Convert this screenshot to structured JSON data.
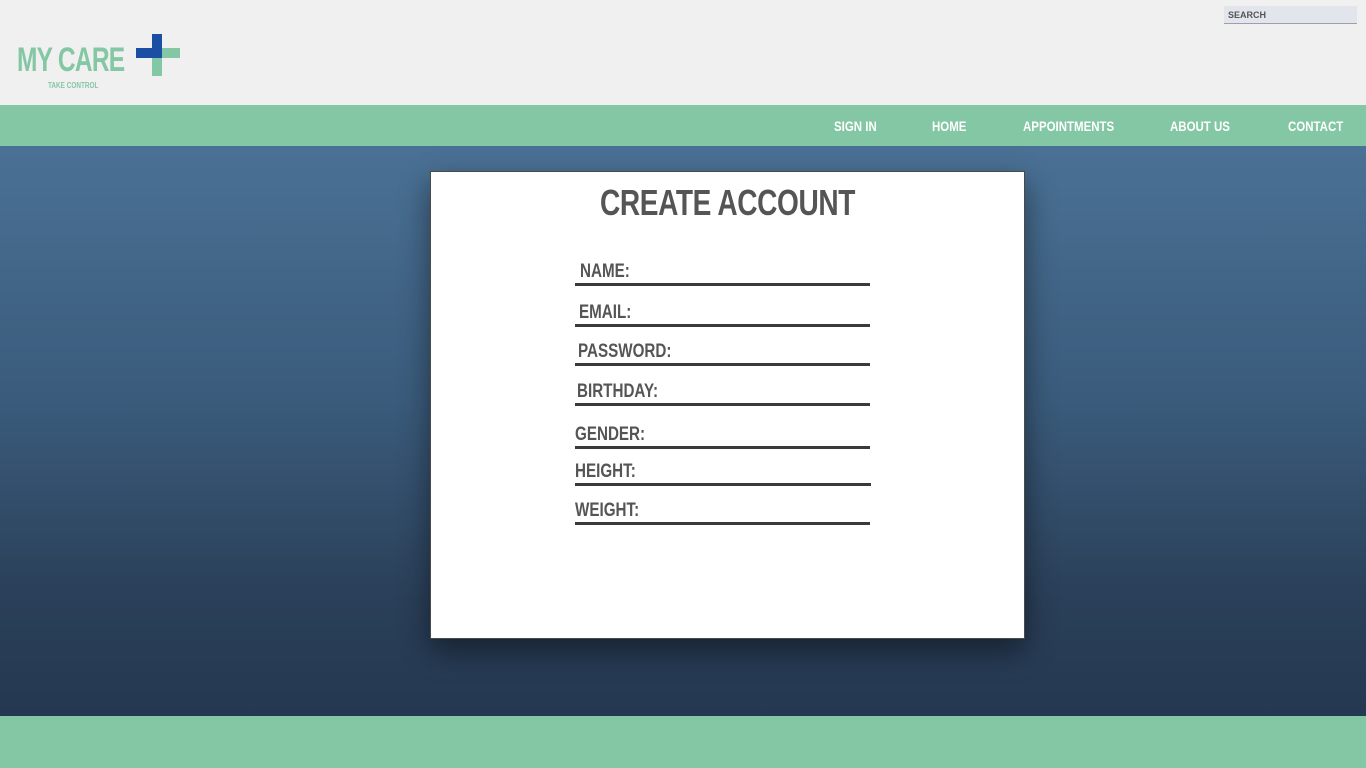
{
  "brand": {
    "name": "MY CARE",
    "tagline": "TAKE CONTROL",
    "cross_colors": {
      "vertical": "#1b4fa3",
      "horizontal": "#84c7a4"
    }
  },
  "search": {
    "placeholder": "SEARCH",
    "value": ""
  },
  "nav": {
    "items": [
      {
        "label": "SIGN IN"
      },
      {
        "label": "HOME"
      },
      {
        "label": "APPOINTMENTS"
      },
      {
        "label": "ABOUT US"
      },
      {
        "label": "CONTACT"
      }
    ]
  },
  "form": {
    "title": "CREATE ACCOUNT",
    "fields": [
      {
        "label": "NAME:",
        "value": ""
      },
      {
        "label": "EMAIL:",
        "value": ""
      },
      {
        "label": "PASSWORD:",
        "value": ""
      },
      {
        "label": "BIRTHDAY:",
        "value": ""
      },
      {
        "label": "GENDER:",
        "value": ""
      },
      {
        "label": "HEIGHT:",
        "value": ""
      },
      {
        "label": "WEIGHT:",
        "value": ""
      }
    ]
  },
  "colors": {
    "accent_green": "#84c7a4",
    "header_bg": "#f0f0f0",
    "main_gradient_top": "#4a7195",
    "main_gradient_bottom": "#253852",
    "text_gray": "#555555"
  }
}
